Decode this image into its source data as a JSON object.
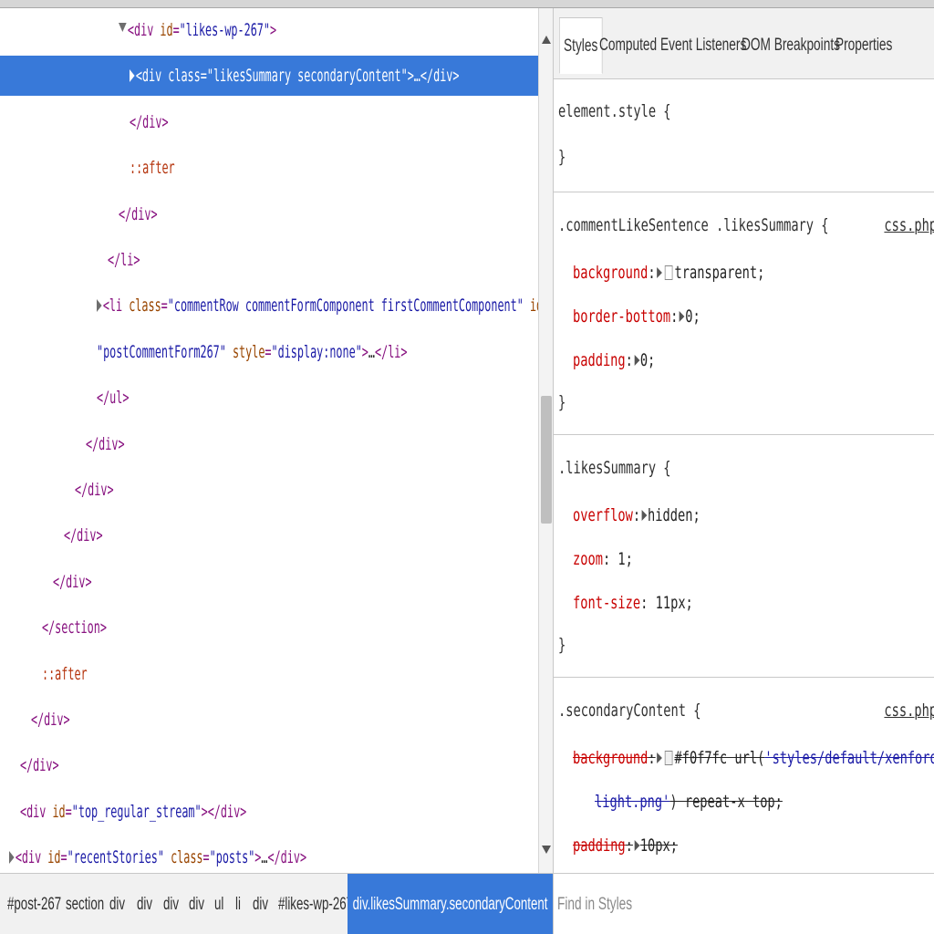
{
  "tree": {
    "lines": [
      {
        "indent": 130,
        "arrow": "open",
        "parts": [
          [
            "tag",
            "<div "
          ],
          [
            "an",
            "id"
          ],
          [
            "eq",
            "="
          ],
          [
            "av",
            "\"likes-wp-267\""
          ],
          [
            "tag",
            ">"
          ]
        ]
      },
      {
        "indent": 142,
        "arrow": "closed",
        "selected": true,
        "parts": [
          [
            "tag",
            "<div "
          ],
          [
            "an",
            "class"
          ],
          [
            "eq",
            "="
          ],
          [
            "av",
            "\"likesSummary secondaryContent\""
          ],
          [
            "tag",
            ">"
          ],
          [
            "tx",
            "…"
          ],
          [
            "tag",
            "</div>"
          ]
        ]
      },
      {
        "indent": 142,
        "parts": [
          [
            "tag",
            "</div>"
          ]
        ]
      },
      {
        "indent": 142,
        "parts": [
          [
            "pseudo",
            "::after"
          ]
        ]
      },
      {
        "indent": 130,
        "parts": [
          [
            "tag",
            "</div>"
          ]
        ]
      },
      {
        "indent": 118,
        "parts": [
          [
            "tag",
            "</li>"
          ]
        ]
      },
      {
        "indent": 106,
        "arrow": "closed",
        "parts": [
          [
            "tag",
            "<li "
          ],
          [
            "an",
            "class"
          ],
          [
            "eq",
            "="
          ],
          [
            "av",
            "\"commentRow commentFormComponent firstCommentComponent\""
          ],
          [
            "tag",
            " "
          ],
          [
            "an",
            "id"
          ],
          [
            "eq",
            "="
          ]
        ]
      },
      {
        "indent": 106,
        "parts": [
          [
            "av",
            "\"postCommentForm267\""
          ],
          [
            "tag",
            " "
          ],
          [
            "an",
            "style"
          ],
          [
            "eq",
            "="
          ],
          [
            "av",
            "\"display:none\""
          ],
          [
            "tag",
            ">"
          ],
          [
            "tx",
            "…"
          ],
          [
            "tag",
            "</li>"
          ]
        ]
      },
      {
        "indent": 106,
        "parts": [
          [
            "tag",
            "</ul>"
          ]
        ]
      },
      {
        "indent": 94,
        "parts": [
          [
            "tag",
            "</div>"
          ]
        ]
      },
      {
        "indent": 82,
        "parts": [
          [
            "tag",
            "</div>"
          ]
        ]
      },
      {
        "indent": 70,
        "parts": [
          [
            "tag",
            "</div>"
          ]
        ]
      },
      {
        "indent": 58,
        "parts": [
          [
            "tag",
            "</div>"
          ]
        ]
      },
      {
        "indent": 46,
        "parts": [
          [
            "tag",
            "</section>"
          ]
        ]
      },
      {
        "indent": 46,
        "parts": [
          [
            "pseudo",
            "::after"
          ]
        ]
      },
      {
        "indent": 34,
        "parts": [
          [
            "tag",
            "</div>"
          ]
        ]
      },
      {
        "indent": 22,
        "parts": [
          [
            "tag",
            "</div>"
          ]
        ]
      },
      {
        "indent": 22,
        "parts": [
          [
            "tag",
            "<div "
          ],
          [
            "an",
            "id"
          ],
          [
            "eq",
            "="
          ],
          [
            "av",
            "\"top_regular_stream\""
          ],
          [
            "tag",
            "></div>"
          ]
        ]
      },
      {
        "indent": 10,
        "arrow": "closed",
        "parts": [
          [
            "tag",
            "<div "
          ],
          [
            "an",
            "id"
          ],
          [
            "eq",
            "="
          ],
          [
            "av",
            "\"recentStories\""
          ],
          [
            "tag",
            " "
          ],
          [
            "an",
            "class"
          ],
          [
            "eq",
            "="
          ],
          [
            "av",
            "\"posts\""
          ],
          [
            "tag",
            ">"
          ],
          [
            "tx",
            "…"
          ],
          [
            "tag",
            "</div>"
          ]
        ]
      }
    ]
  },
  "tabs": [
    "Styles",
    "Computed",
    "Event Listeners",
    "DOM Breakpoints",
    "Properties"
  ],
  "styles": {
    "element_style": {
      "selector": "element.style {",
      "close": "}"
    },
    "rule1": {
      "selector": ".commentLikeSentence .likesSummary {",
      "file": "css.php",
      "props": [
        {
          "name": "background",
          "value": "transparent;",
          "swatch": true,
          "tri": true
        },
        {
          "name": "border-bottom",
          "value": "0;",
          "tri": true
        },
        {
          "name": "padding",
          "value": "0;",
          "tri": true
        }
      ],
      "close": "}"
    },
    "rule2": {
      "selector": ".likesSummary {",
      "props": [
        {
          "name": "overflow",
          "value": "hidden;",
          "tri": true
        },
        {
          "name": "zoom",
          "value": "1;"
        },
        {
          "name": "font-size",
          "value": "11px;"
        }
      ],
      "close": "}"
    },
    "rule3": {
      "selector": ".secondaryContent {",
      "file": "css.php",
      "background_name": "background",
      "background_color": "#F0F7FC",
      "background_color_text": "#f0f7fc url(",
      "background_url_1": "'styles/default/xenforo/gradients/",
      "background_url_2": "light.png'",
      "background_rest": ") repeat-x top;",
      "padding_name": "padding",
      "padding_value": "10px;"
    }
  },
  "breadcrumbs": [
    "#post-267",
    "section",
    "div",
    "div",
    "div",
    "div",
    "ul",
    "li",
    "div",
    "#likes-wp-267",
    "div.likesSummary.secondaryContent"
  ],
  "find": {
    "placeholder": "Find in Styles"
  },
  "colors": {
    "selection": "#3879D9",
    "tag": "#881280",
    "attr_name": "#994500",
    "attr_value": "#1A1AA6",
    "css_prop": "#C80000"
  }
}
